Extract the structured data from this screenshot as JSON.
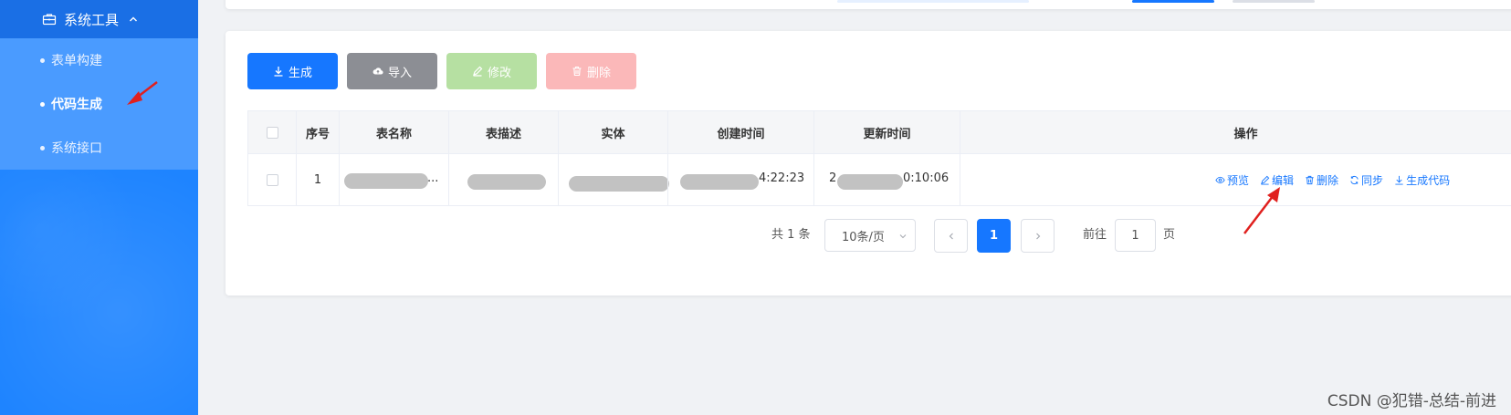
{
  "sidebar": {
    "parent_label": "系统工具",
    "items": [
      {
        "label": "表单构建",
        "active": false
      },
      {
        "label": "代码生成",
        "active": true
      },
      {
        "label": "系统接口",
        "active": false
      }
    ]
  },
  "toolbar": {
    "generate": "生成",
    "import": "导入",
    "edit": "修改",
    "delete": "删除"
  },
  "table": {
    "headers": [
      "序号",
      "表名称",
      "表描述",
      "实体",
      "创建时间",
      "更新时间",
      "操作"
    ],
    "rows": [
      {
        "index": "1",
        "table_name_tail": "...",
        "create_time_tail": "4:22:23",
        "update_time_head": "2",
        "update_time_tail": "0:10:06"
      }
    ],
    "actions": [
      "预览",
      "编辑",
      "删除",
      "同步",
      "生成代码"
    ]
  },
  "pagination": {
    "total": "共 1 条",
    "page_size": "10条/页",
    "current_page": "1",
    "goto_label": "前往",
    "goto_value": "1",
    "page_suffix": "页"
  },
  "watermark": "CSDN @犯错-总结-前进",
  "colors": {
    "primary": "#1677ff",
    "sidebar": "#1e84ff",
    "annotation": "#e0201e"
  }
}
